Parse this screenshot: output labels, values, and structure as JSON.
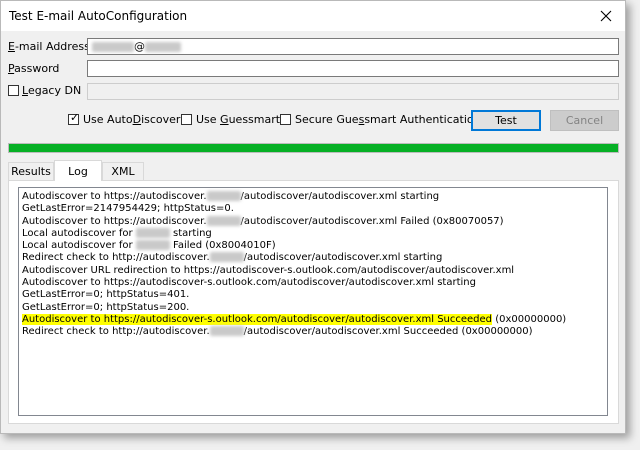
{
  "window": {
    "title": "Test E-mail AutoConfiguration"
  },
  "fields": {
    "email": {
      "label": "E-mail Address",
      "mnemonic": "E",
      "value_at": "@"
    },
    "password": {
      "label": "Password",
      "mnemonic": "P",
      "value": ""
    },
    "legacy_dn": {
      "label": "Legacy DN",
      "mnemonic": "L",
      "checked": false,
      "value": ""
    }
  },
  "options": {
    "use_autodiscover": {
      "label": "Use AutoDiscover",
      "checked": true
    },
    "use_guessmart": {
      "label": "Use Guessmart",
      "checked": false
    },
    "secure_guessmart": {
      "label": "Secure Guessmart Authentication",
      "checked": false
    }
  },
  "buttons": {
    "test": "Test",
    "cancel": "Cancel"
  },
  "progress": {
    "percent": 100,
    "color": "#06b025"
  },
  "tabs": [
    {
      "label": "Results",
      "active": false
    },
    {
      "label": "Log",
      "active": true
    },
    {
      "label": "XML",
      "active": false
    }
  ],
  "log": [
    {
      "parts": [
        "Autodiscover to https://autodiscover.",
        "[redacted]",
        "/autodiscover/autodiscover.xml starting"
      ],
      "highlight": false
    },
    {
      "parts": [
        "GetLastError=2147954429; httpStatus=0."
      ],
      "highlight": false
    },
    {
      "parts": [
        "Autodiscover to https://autodiscover.",
        "[redacted]",
        "/autodiscover/autodiscover.xml Failed (0x80070057)"
      ],
      "highlight": false
    },
    {
      "parts": [
        "Local autodiscover for ",
        "[redacted]",
        " starting"
      ],
      "highlight": false
    },
    {
      "parts": [
        "Local autodiscover for ",
        "[redacted]",
        " Failed (0x8004010F)"
      ],
      "highlight": false
    },
    {
      "parts": [
        "Redirect check to http://autodiscover.",
        "[redacted]",
        "/autodiscover/autodiscover.xml starting"
      ],
      "highlight": false
    },
    {
      "parts": [
        "Autodiscover URL redirection to https://autodiscover-s.outlook.com/autodiscover/autodiscover.xml"
      ],
      "highlight": false
    },
    {
      "parts": [
        "Autodiscover to https://autodiscover-s.outlook.com/autodiscover/autodiscover.xml starting"
      ],
      "highlight": false
    },
    {
      "parts": [
        "GetLastError=0; httpStatus=401."
      ],
      "highlight": false
    },
    {
      "parts": [
        "GetLastError=0; httpStatus=200."
      ],
      "highlight": false
    },
    {
      "parts": [
        "Autodiscover to https://autodiscover-s.outlook.com/autodiscover/autodiscover.xml Succeeded",
        " (0x00000000)"
      ],
      "highlight": true
    },
    {
      "parts": [
        "Redirect check to http://autodiscover.",
        "[redacted]",
        "/autodiscover/autodiscover.xml Succeeded (0x00000000)"
      ],
      "highlight": false
    }
  ],
  "icons": {
    "close": "close-icon",
    "checkmark": "checkmark-icon"
  },
  "colors": {
    "highlight": "#ffff00",
    "focus_border": "#0078d7"
  }
}
